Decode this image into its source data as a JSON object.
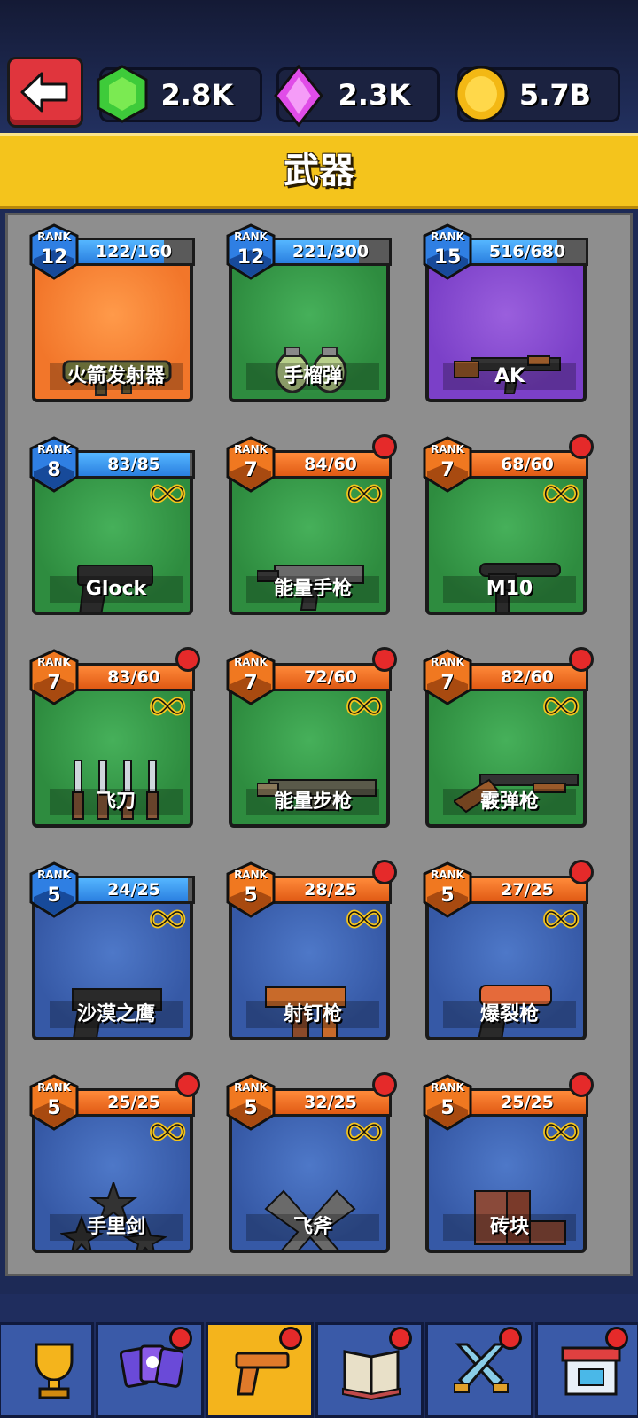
{
  "header": {
    "title": "武器"
  },
  "currencies": [
    {
      "name": "gem-green",
      "value": "2.8K"
    },
    {
      "name": "gem-pink",
      "value": "2.3K"
    },
    {
      "name": "coin",
      "value": "5.7B"
    }
  ],
  "rank_label": "RANK",
  "weapons": [
    {
      "name": "火箭发射器",
      "rank": "12",
      "progress": "122/160",
      "fraction": 0.76,
      "bg": "orange",
      "bar": "blue",
      "dot": false,
      "infinite": false,
      "icon": "rocket-launcher-icon"
    },
    {
      "name": "手榴弹",
      "rank": "12",
      "progress": "221/300",
      "fraction": 0.74,
      "bg": "green",
      "bar": "blue",
      "dot": false,
      "infinite": false,
      "icon": "grenade-icon"
    },
    {
      "name": "AK",
      "rank": "15",
      "progress": "516/680",
      "fraction": 0.76,
      "bg": "purple",
      "bar": "blue",
      "dot": false,
      "infinite": false,
      "icon": "ak-rifle-icon"
    },
    {
      "name": "Glock",
      "rank": "8",
      "progress": "83/85",
      "fraction": 0.98,
      "bg": "green",
      "bar": "blue",
      "dot": false,
      "infinite": true,
      "icon": "pistol-icon"
    },
    {
      "name": "能量手枪",
      "rank": "7",
      "progress": "84/60",
      "fraction": 1,
      "bg": "green",
      "bar": "orange",
      "dot": true,
      "infinite": true,
      "icon": "energy-pistol-icon"
    },
    {
      "name": "M10",
      "rank": "7",
      "progress": "68/60",
      "fraction": 1,
      "bg": "green",
      "bar": "orange",
      "dot": true,
      "infinite": true,
      "icon": "smg-icon"
    },
    {
      "name": "飞刀",
      "rank": "7",
      "progress": "83/60",
      "fraction": 1,
      "bg": "green",
      "bar": "orange",
      "dot": true,
      "infinite": true,
      "icon": "throwing-knife-icon"
    },
    {
      "name": "能量步枪",
      "rank": "7",
      "progress": "72/60",
      "fraction": 1,
      "bg": "green",
      "bar": "orange",
      "dot": true,
      "infinite": true,
      "icon": "energy-rifle-icon"
    },
    {
      "name": "霰弹枪",
      "rank": "7",
      "progress": "82/60",
      "fraction": 1,
      "bg": "green",
      "bar": "orange",
      "dot": true,
      "infinite": true,
      "icon": "shotgun-icon"
    },
    {
      "name": "沙漠之鹰",
      "rank": "5",
      "progress": "24/25",
      "fraction": 0.96,
      "bg": "blue",
      "bar": "blue",
      "dot": false,
      "infinite": true,
      "icon": "desert-eagle-icon"
    },
    {
      "name": "射钉枪",
      "rank": "5",
      "progress": "28/25",
      "fraction": 1,
      "bg": "blue",
      "bar": "orange",
      "dot": true,
      "infinite": true,
      "icon": "nail-gun-icon"
    },
    {
      "name": "爆裂枪",
      "rank": "5",
      "progress": "27/25",
      "fraction": 1,
      "bg": "blue",
      "bar": "orange",
      "dot": true,
      "infinite": true,
      "icon": "flare-gun-icon"
    },
    {
      "name": "手里剑",
      "rank": "5",
      "progress": "25/25",
      "fraction": 1,
      "bg": "blue",
      "bar": "orange",
      "dot": true,
      "infinite": true,
      "icon": "shuriken-icon"
    },
    {
      "name": "飞斧",
      "rank": "5",
      "progress": "32/25",
      "fraction": 1,
      "bg": "blue",
      "bar": "orange",
      "dot": true,
      "infinite": true,
      "icon": "throwing-axe-icon"
    },
    {
      "name": "砖块",
      "rank": "5",
      "progress": "25/25",
      "fraction": 1,
      "bg": "blue",
      "bar": "orange",
      "dot": true,
      "infinite": true,
      "icon": "brick-icon"
    }
  ],
  "nav": [
    {
      "name": "trophy",
      "active": false,
      "dot": false
    },
    {
      "name": "cards",
      "active": false,
      "dot": true
    },
    {
      "name": "weapons",
      "active": true,
      "dot": true
    },
    {
      "name": "book",
      "active": false,
      "dot": true
    },
    {
      "name": "battle",
      "active": false,
      "dot": true
    },
    {
      "name": "shop",
      "active": false,
      "dot": true
    }
  ],
  "colors": {
    "header": "#f4c41c",
    "back": "#e0353d",
    "badge_blue": "#2f7fe3",
    "badge_orange": "#f07820",
    "notify": "#e52a2a"
  }
}
